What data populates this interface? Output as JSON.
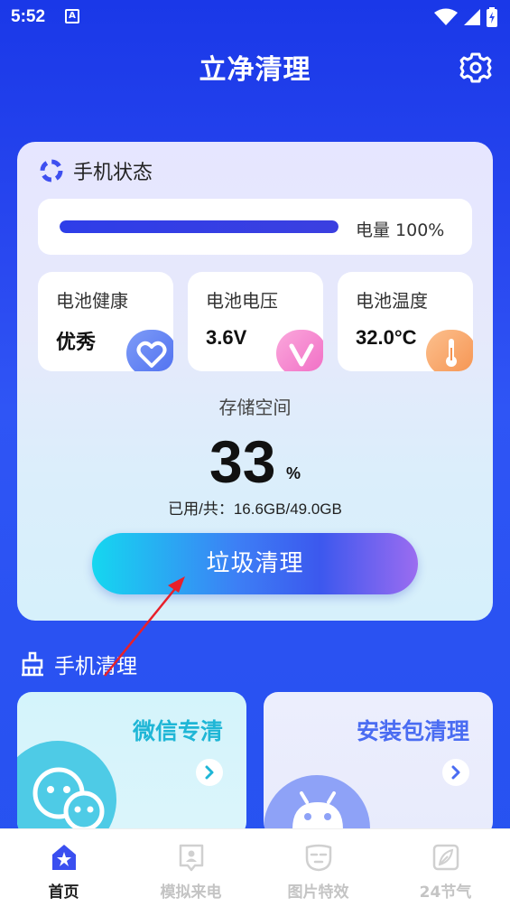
{
  "status_bar": {
    "time": "5:52",
    "notification_letter": "A"
  },
  "header": {
    "title": "立净清理",
    "settings_icon": "gear-icon"
  },
  "phone_status": {
    "title": "手机状态",
    "battery": {
      "label": "电量 100%",
      "level": 1.0
    },
    "stats": [
      {
        "label": "电池健康",
        "value": "优秀",
        "icon": "heart-icon",
        "color": "#5a7cf0"
      },
      {
        "label": "电池电压",
        "value": "3.6V",
        "icon": "voltage-v-icon",
        "color": "#f27bcb"
      },
      {
        "label": "电池温度",
        "value": "32.0°C",
        "icon": "thermometer-icon",
        "color": "#f5a063"
      }
    ],
    "storage": {
      "label": "存储空间",
      "percent": "33",
      "percent_sign": "%",
      "detail": "已用/共：16.6GB/49.0GB"
    },
    "clean_button": "垃圾清理"
  },
  "cleaning": {
    "title": "手机清理",
    "cards": [
      {
        "title": "微信专清",
        "color": "#1fb6d6"
      },
      {
        "title": "安装包清理",
        "color": "#4a6cf2"
      }
    ]
  },
  "nav": [
    {
      "label": "首页",
      "active": true
    },
    {
      "label": "模拟来电",
      "active": false
    },
    {
      "label": "图片特效",
      "active": false
    },
    {
      "label": "24节气",
      "active": false
    }
  ],
  "colors": {
    "primary": "#2a49f0",
    "annotation_arrow": "#e8202a"
  }
}
